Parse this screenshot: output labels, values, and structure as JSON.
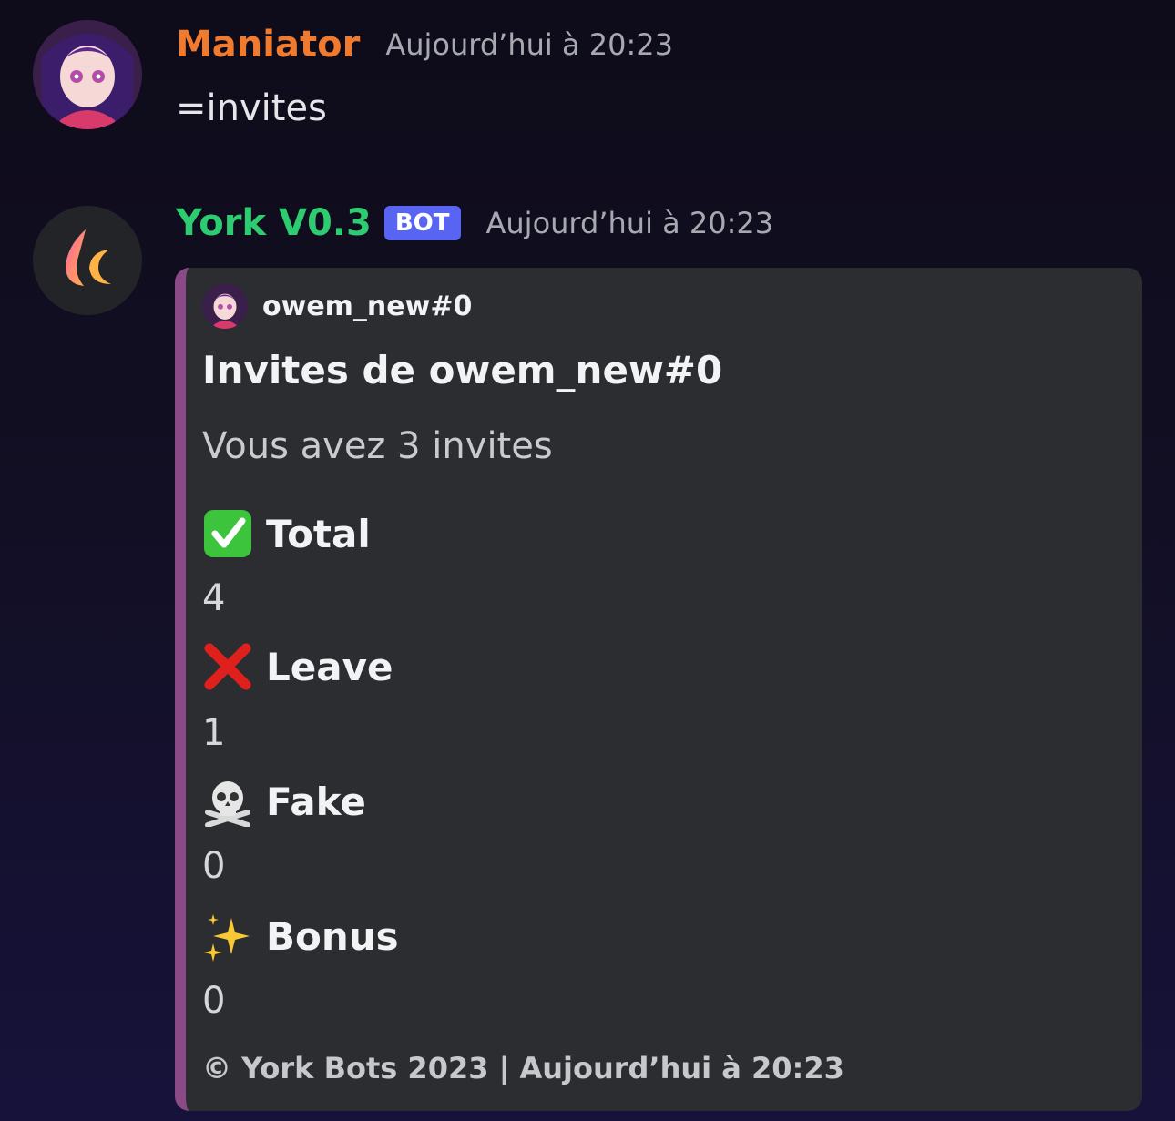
{
  "messages": [
    {
      "username": "Maniator",
      "timestamp": "Aujourd’hui à 20:23",
      "content": "=invites",
      "color": "#f07a2e"
    },
    {
      "username": "York V0.3",
      "tag": "BOT",
      "timestamp": "Aujourd’hui à 20:23",
      "color": "#2ecc71",
      "embed": {
        "accent_color": "#8a4a86",
        "author": "owem_new#0",
        "title": "Invites de owem_new#0",
        "description": "Vous avez 3 invites",
        "fields": [
          {
            "icon": "check-mark-icon",
            "name": "Total",
            "value": "4"
          },
          {
            "icon": "cross-mark-icon",
            "name": "Leave",
            "value": "1"
          },
          {
            "icon": "skull-crossbones-icon",
            "name": "Fake",
            "value": "0"
          },
          {
            "icon": "sparkles-icon",
            "name": "Bonus",
            "value": "0"
          }
        ],
        "footer": "© York Bots 2023 | Aujourd’hui à 20:23"
      }
    }
  ]
}
